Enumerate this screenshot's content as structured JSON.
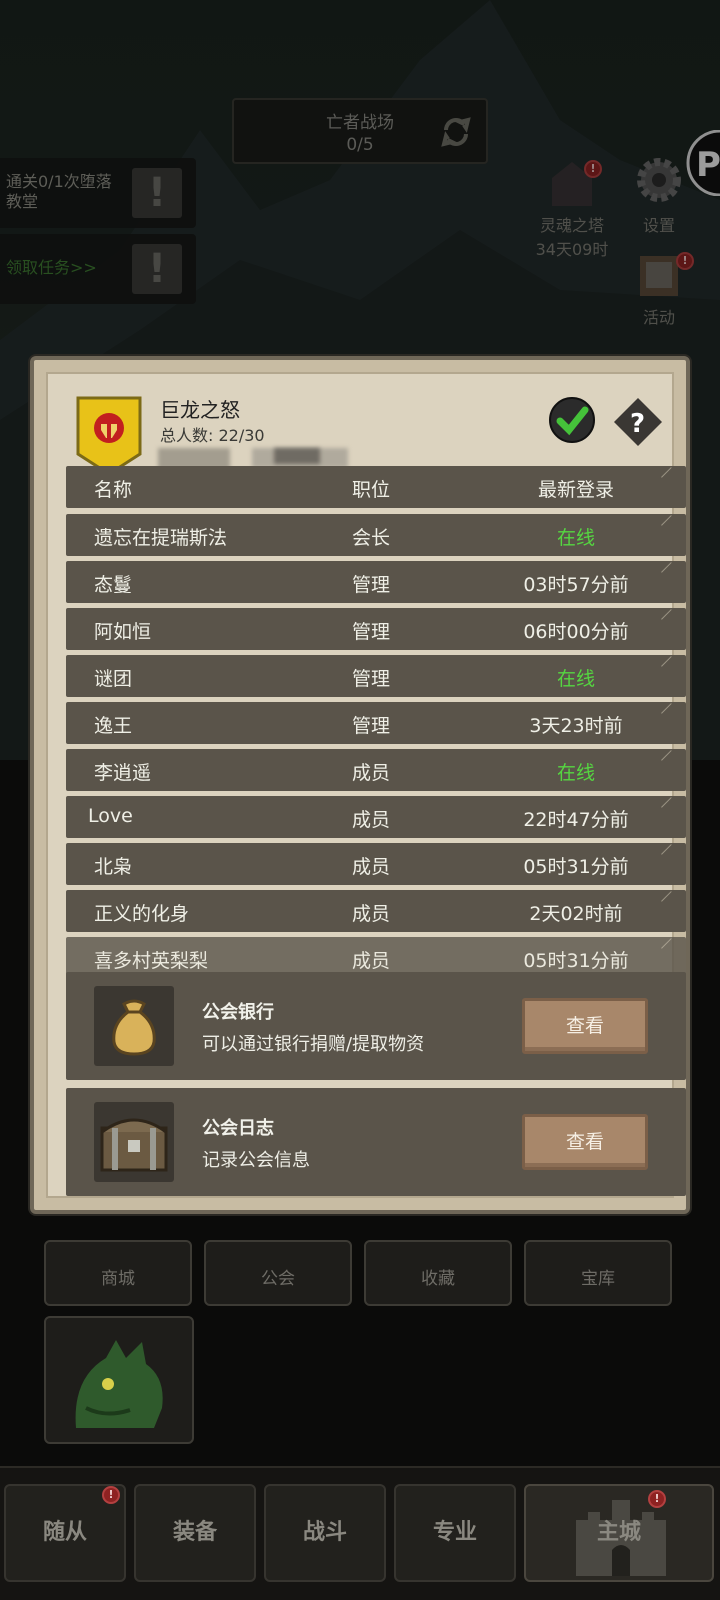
{
  "top": {
    "battle_title": "亡者战场",
    "battle_count": "0/5"
  },
  "quests": [
    {
      "text": "通关0/1次堕落教堂",
      "icon": "exclamation-icon"
    },
    {
      "text": "领取任务>>",
      "icon": "exclamation-icon"
    }
  ],
  "side": {
    "tower_label": "灵魂之塔",
    "tower_timer": "34天09时",
    "settings_label": "设置",
    "events_label": "活动"
  },
  "guild": {
    "name": "巨龙之怒",
    "member_count": "总人数: 22/30"
  },
  "table": {
    "headers": [
      "名称",
      "职位",
      "最新登录"
    ],
    "rows": [
      {
        "name": "遗忘在提瑞斯法",
        "role": "会长",
        "login": "在线",
        "online": true
      },
      {
        "name": "态鬘",
        "role": "管理",
        "login": "03时57分前",
        "online": false
      },
      {
        "name": "阿如恒",
        "role": "管理",
        "login": "06时00分前",
        "online": false
      },
      {
        "name": "谜团",
        "role": "管理",
        "login": "在线",
        "online": true
      },
      {
        "name": "逸王",
        "role": "管理",
        "login": "3天23时前",
        "online": false
      },
      {
        "name": "李逍遥",
        "role": "成员",
        "login": "在线",
        "online": true
      },
      {
        "name": "Love",
        "role": "成员",
        "login": "22时47分前",
        "online": false
      },
      {
        "name": "北枭",
        "role": "成员",
        "login": "05时31分前",
        "online": false
      },
      {
        "name": "正义的化身",
        "role": "成员",
        "login": "2天02时前",
        "online": false
      },
      {
        "name": "喜多村英梨梨",
        "role": "成员",
        "login": "05时31分前",
        "online": false
      }
    ]
  },
  "bank": {
    "title": "公会银行",
    "desc": "可以通过银行捐赠/提取物资",
    "button": "查看"
  },
  "log": {
    "title": "公会日志",
    "desc": "记录公会信息",
    "button": "查看"
  },
  "tiles": [
    "商城",
    "公会",
    "收藏",
    "宝库"
  ],
  "nav": [
    "随从",
    "装备",
    "战斗",
    "专业",
    "主城"
  ],
  "colors": {
    "online_green": "#55d641",
    "row_bg": "#5a544a",
    "panel_bg": "#dcd3bf",
    "alert_red": "#8e2222"
  }
}
